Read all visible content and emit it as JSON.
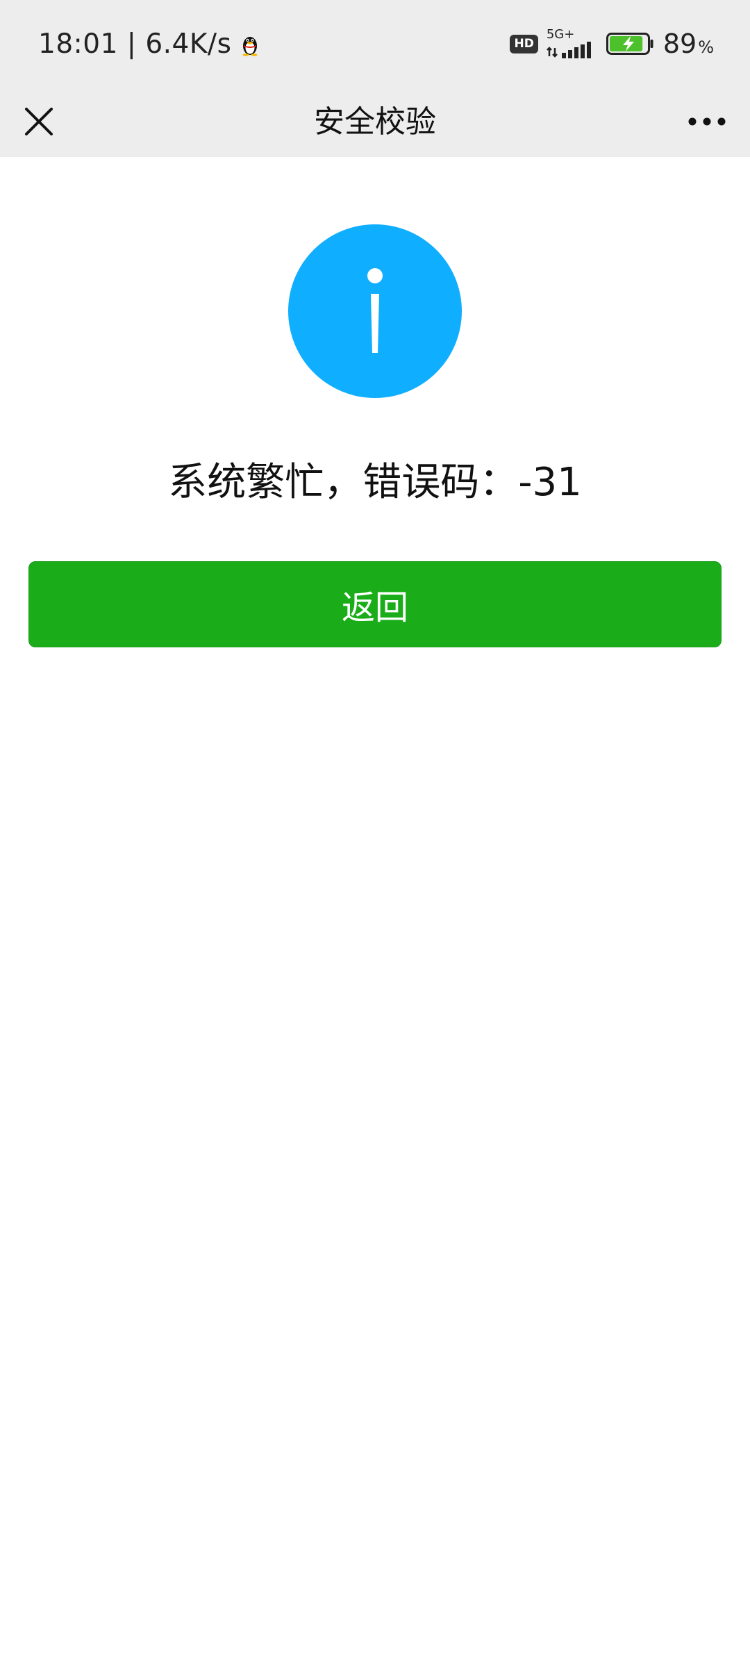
{
  "status_bar": {
    "time_speed": "18:01 | 6.4K/s",
    "qq_icon": "qq-penguin-icon",
    "hd_label": "HD",
    "network_label": "5G+",
    "battery_percent": "89",
    "battery_unit": "%",
    "battery_level": 0.89,
    "battery_charging": true,
    "battery_color": "#4cc12c"
  },
  "nav": {
    "title": "安全校验",
    "close_icon": "close-icon",
    "more_icon": "more-icon"
  },
  "content": {
    "icon": "info-icon",
    "icon_color": "#10aeff",
    "message": "系统繁忙，错误码：-31",
    "button_label": "返回",
    "button_color": "#1aad19"
  }
}
